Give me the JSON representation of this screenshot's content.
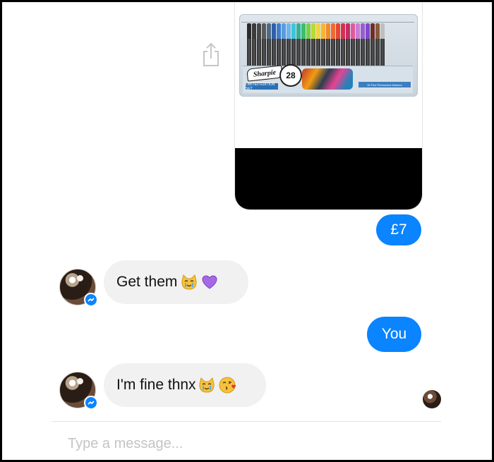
{
  "thread": {
    "image_message": {
      "brand_text": "Sharpie",
      "count_text": "28",
      "edition_text": "LIMITED EDITION SET",
      "caption_text": "28 Fine Permanent Markers",
      "marker_colors": [
        "#2b2b2b",
        "#3a3a3a",
        "#474747",
        "#5a5a5a",
        "#4e6a86",
        "#2f5fa8",
        "#3e7fd1",
        "#5a9be0",
        "#6cb6ea",
        "#3ec5d6",
        "#2fb39a",
        "#3bbf6a",
        "#7bcf45",
        "#b8d93a",
        "#f2d43a",
        "#f7b534",
        "#f5892e",
        "#ef6a2f",
        "#e74434",
        "#d6314a",
        "#c62a6c",
        "#e05a9b",
        "#c77dd4",
        "#9b5bd2",
        "#7a4cc6",
        "#6d2e2e",
        "#8a5a3a",
        "#bfbfbf"
      ]
    },
    "messages": [
      {
        "direction": "outgoing",
        "text": "£7"
      },
      {
        "direction": "incoming",
        "text": "Get them",
        "emojis": [
          "crying-cat-icon",
          "purple-heart-icon"
        ]
      },
      {
        "direction": "outgoing",
        "text": "You"
      },
      {
        "direction": "incoming",
        "text": "I'm fine thnx",
        "emojis": [
          "crying-cat-icon",
          "kissing-face-icon"
        ]
      }
    ]
  },
  "composer": {
    "placeholder": "Type a message..."
  },
  "colors": {
    "outgoing_bubble": "#0a84ff",
    "incoming_bubble": "#f1f1f1",
    "messenger_badge": "#0a84ff"
  }
}
